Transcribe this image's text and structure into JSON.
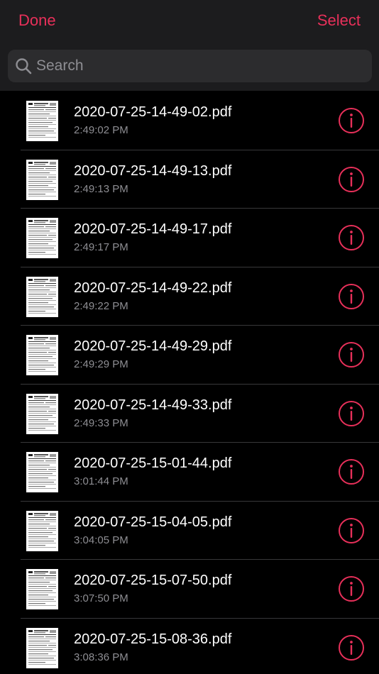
{
  "nav": {
    "done_label": "Done",
    "select_label": "Select"
  },
  "search": {
    "placeholder": "Search",
    "value": ""
  },
  "colors": {
    "accent": "#e8305a",
    "background": "#000000",
    "secondary_text": "#8e8e93"
  },
  "files": [
    {
      "name": "2020-07-25-14-49-02.pdf",
      "time": "2:49:02 PM"
    },
    {
      "name": "2020-07-25-14-49-13.pdf",
      "time": "2:49:13 PM"
    },
    {
      "name": "2020-07-25-14-49-17.pdf",
      "time": "2:49:17 PM"
    },
    {
      "name": "2020-07-25-14-49-22.pdf",
      "time": "2:49:22 PM"
    },
    {
      "name": "2020-07-25-14-49-29.pdf",
      "time": "2:49:29 PM"
    },
    {
      "name": "2020-07-25-14-49-33.pdf",
      "time": "2:49:33 PM"
    },
    {
      "name": "2020-07-25-15-01-44.pdf",
      "time": "3:01:44 PM"
    },
    {
      "name": "2020-07-25-15-04-05.pdf",
      "time": "3:04:05 PM"
    },
    {
      "name": "2020-07-25-15-07-50.pdf",
      "time": "3:07:50 PM"
    },
    {
      "name": "2020-07-25-15-08-36.pdf",
      "time": "3:08:36 PM"
    }
  ]
}
